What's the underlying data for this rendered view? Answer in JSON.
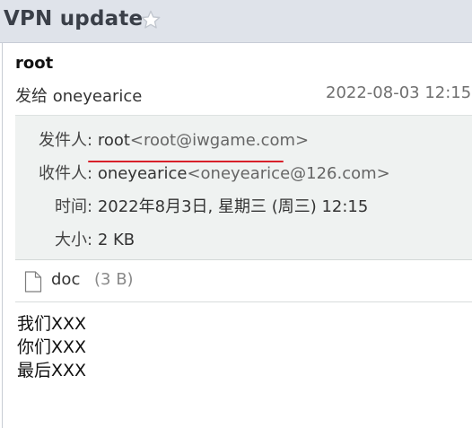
{
  "header": {
    "title": "VPN update",
    "star_icon": "star-outline-icon"
  },
  "message": {
    "from_name": "root",
    "to_summary_prefix": "发给",
    "to_summary_name": "oneyearice",
    "date_time": "2022-08-03 12:15"
  },
  "details": {
    "from_label": "发件人:",
    "from_name": "root",
    "from_addr": "<root@iwgame.com>",
    "to_label": "收件人:",
    "to_name": "oneyearice",
    "to_addr": "<oneyearice@126.com>",
    "time_label": "时间:",
    "time_value": "2022年8月3日, 星期三 (周三) 12:15",
    "size_label": "大小:",
    "size_value": "2 KB",
    "highlight_color": "#d8202a"
  },
  "attachment": {
    "icon": "file-icon",
    "name": "doc",
    "size": "(3 B)"
  },
  "body": {
    "lines": [
      "我们XXX",
      "你们XXX",
      "最后XXX"
    ]
  }
}
